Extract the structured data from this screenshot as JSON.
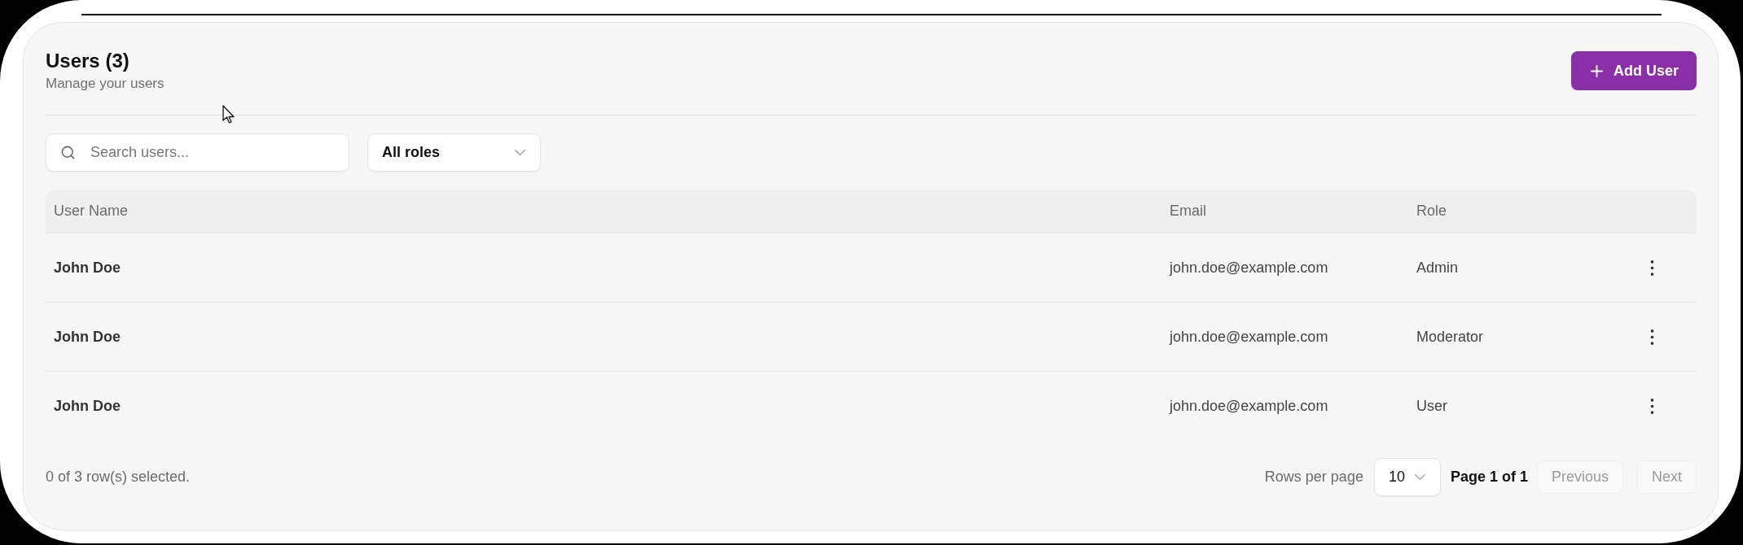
{
  "header": {
    "title": "Users (3)",
    "subtitle": "Manage your users",
    "add_button": {
      "label": "Add User"
    }
  },
  "filters": {
    "search": {
      "placeholder": "Search users..."
    },
    "role_select": {
      "value": "All roles"
    }
  },
  "table": {
    "columns": [
      "User Name",
      "Email",
      "Role"
    ],
    "rows": [
      {
        "user_name": "John Doe",
        "email": "john.doe@example.com",
        "role": "Admin"
      },
      {
        "user_name": "John Doe",
        "email": "john.doe@example.com",
        "role": "Moderator"
      },
      {
        "user_name": "John Doe",
        "email": "john.doe@example.com",
        "role": "User"
      }
    ]
  },
  "footer": {
    "selection": "0 of 3 row(s) selected.",
    "rows_per_page": {
      "label": "Rows per page",
      "value": "10"
    },
    "page": "Page 1 of 1",
    "buttons": [
      {
        "label": "Previous",
        "disabled": true
      },
      {
        "label": "Next",
        "disabled": true
      }
    ]
  }
}
